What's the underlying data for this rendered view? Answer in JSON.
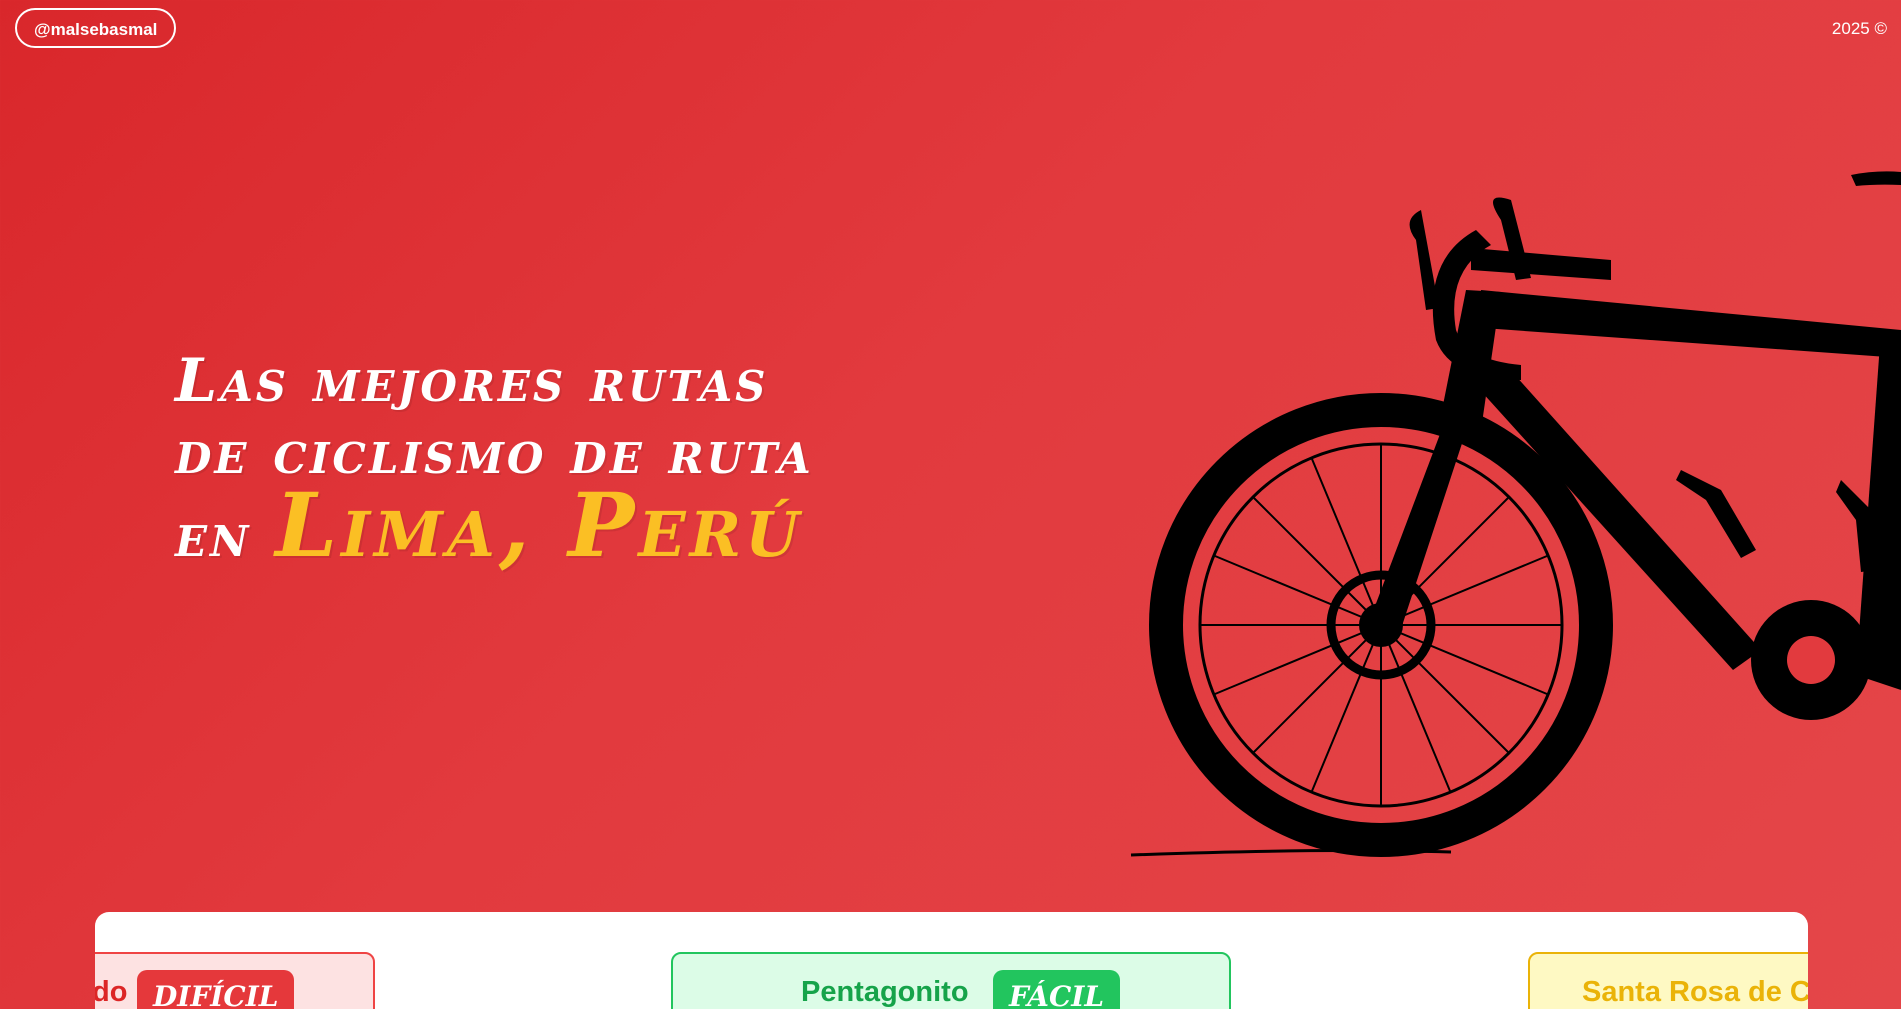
{
  "header": {
    "handle": "@malsebasmal",
    "copyright": "2025 ©"
  },
  "hero": {
    "line1": "Las mejores rutas",
    "line2": "de ciclismo de ruta",
    "line3_prefix": "en",
    "line3_accent": "Lima, Perú"
  },
  "bike_icon": "road-bike-silhouette-icon",
  "colors": {
    "background": "#de2f33",
    "accent": "#fbbf24",
    "hard": "#e5383b",
    "easy": "#22c55e",
    "medium": "#eab308"
  },
  "routes": [
    {
      "name": "do",
      "difficulty": "DIFÍCIL"
    },
    {
      "name": "Pentagonito",
      "difficulty": "FÁCIL"
    },
    {
      "name": "Santa Rosa de C"
    }
  ]
}
